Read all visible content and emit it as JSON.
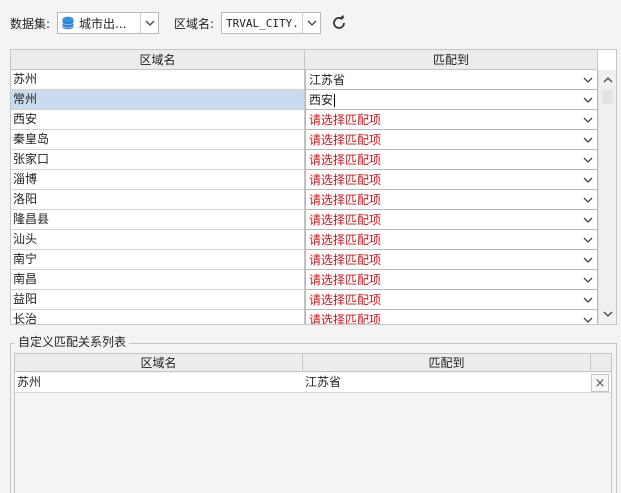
{
  "toolbar": {
    "dataset_label": "数据集:",
    "dataset_value": "城市出...",
    "region_label": "区域名:",
    "region_value": "TRVAL_CITY.",
    "icons": {
      "dataset": "database-icon",
      "refresh": "refresh-icon"
    }
  },
  "grid": {
    "columns": [
      "区域名",
      "匹配到"
    ],
    "rows": [
      {
        "name": "苏州",
        "match": "江苏省",
        "placeholder": false
      },
      {
        "name": "常州",
        "match": "西安",
        "placeholder": false,
        "selected": true,
        "editing": true
      },
      {
        "name": "西安",
        "match": "请选择匹配项",
        "placeholder": true
      },
      {
        "name": "秦皇岛",
        "match": "请选择匹配项",
        "placeholder": true
      },
      {
        "name": "张家口",
        "match": "请选择匹配项",
        "placeholder": true
      },
      {
        "name": "淄博",
        "match": "请选择匹配项",
        "placeholder": true
      },
      {
        "name": "洛阳",
        "match": "请选择匹配项",
        "placeholder": true
      },
      {
        "name": "隆昌县",
        "match": "请选择匹配项",
        "placeholder": true
      },
      {
        "name": "汕头",
        "match": "请选择匹配项",
        "placeholder": true
      },
      {
        "name": "南宁",
        "match": "请选择匹配项",
        "placeholder": true
      },
      {
        "name": "南昌",
        "match": "请选择匹配项",
        "placeholder": true
      },
      {
        "name": "益阳",
        "match": "请选择匹配项",
        "placeholder": true
      },
      {
        "name": "长治",
        "match": "请选择匹配项",
        "placeholder": true
      }
    ]
  },
  "custom": {
    "title": "自定义匹配关系列表",
    "columns": [
      "区域名",
      "匹配到"
    ],
    "rows": [
      {
        "name": "苏州",
        "match": "江苏省"
      }
    ],
    "delete_symbol": "×"
  },
  "colors": {
    "placeholder_text": "#d4141a",
    "selected_row": "#c9dcee"
  }
}
